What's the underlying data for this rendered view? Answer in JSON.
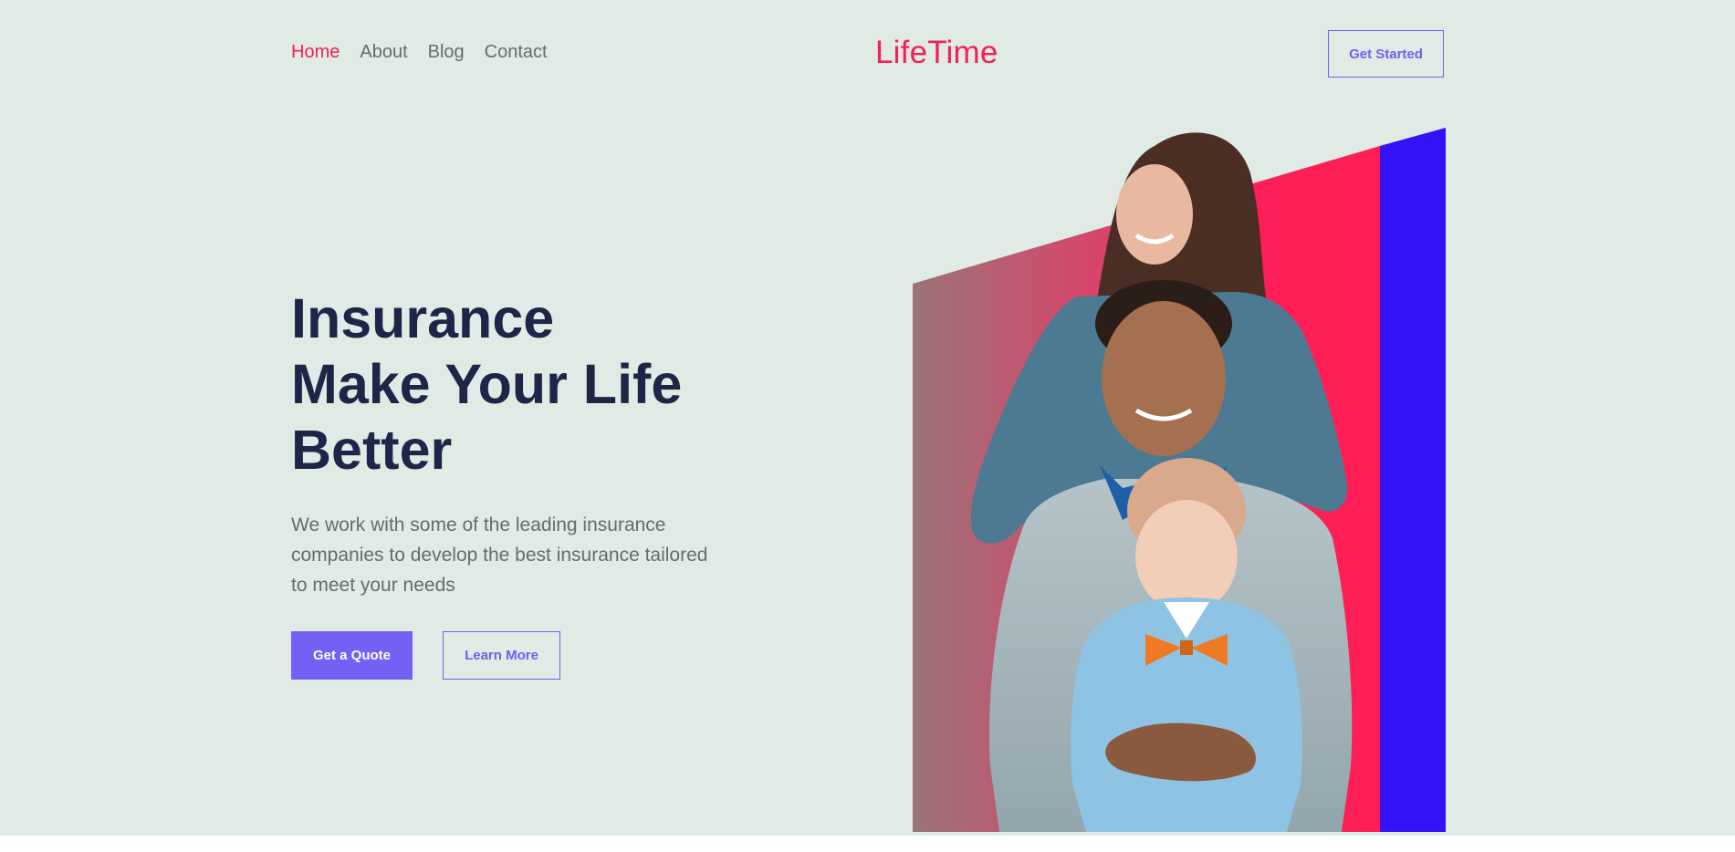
{
  "nav": {
    "items": [
      {
        "label": "Home",
        "active": true
      },
      {
        "label": "About",
        "active": false
      },
      {
        "label": "Blog",
        "active": false
      },
      {
        "label": "Contact",
        "active": false
      }
    ]
  },
  "brand": {
    "logo_text": "LifeTime"
  },
  "header": {
    "cta_label": "Get Started"
  },
  "hero": {
    "title_lines": [
      "Insurance",
      "Make Your Life",
      "Better"
    ],
    "description": "We work with some of the leading insurance companies to develop the best insurance tailored to meet your needs",
    "primary_button": "Get a Quote",
    "secondary_button": "Learn More",
    "image_alt_icon": "family-photo"
  },
  "colors": {
    "background": "#e0ebe5",
    "brand_pink": "#f31f58",
    "accent_purple": "#7560f5",
    "heading_navy": "#1f2547",
    "body_gray": "#6a6a6a",
    "visual_blue": "#3412f7"
  }
}
